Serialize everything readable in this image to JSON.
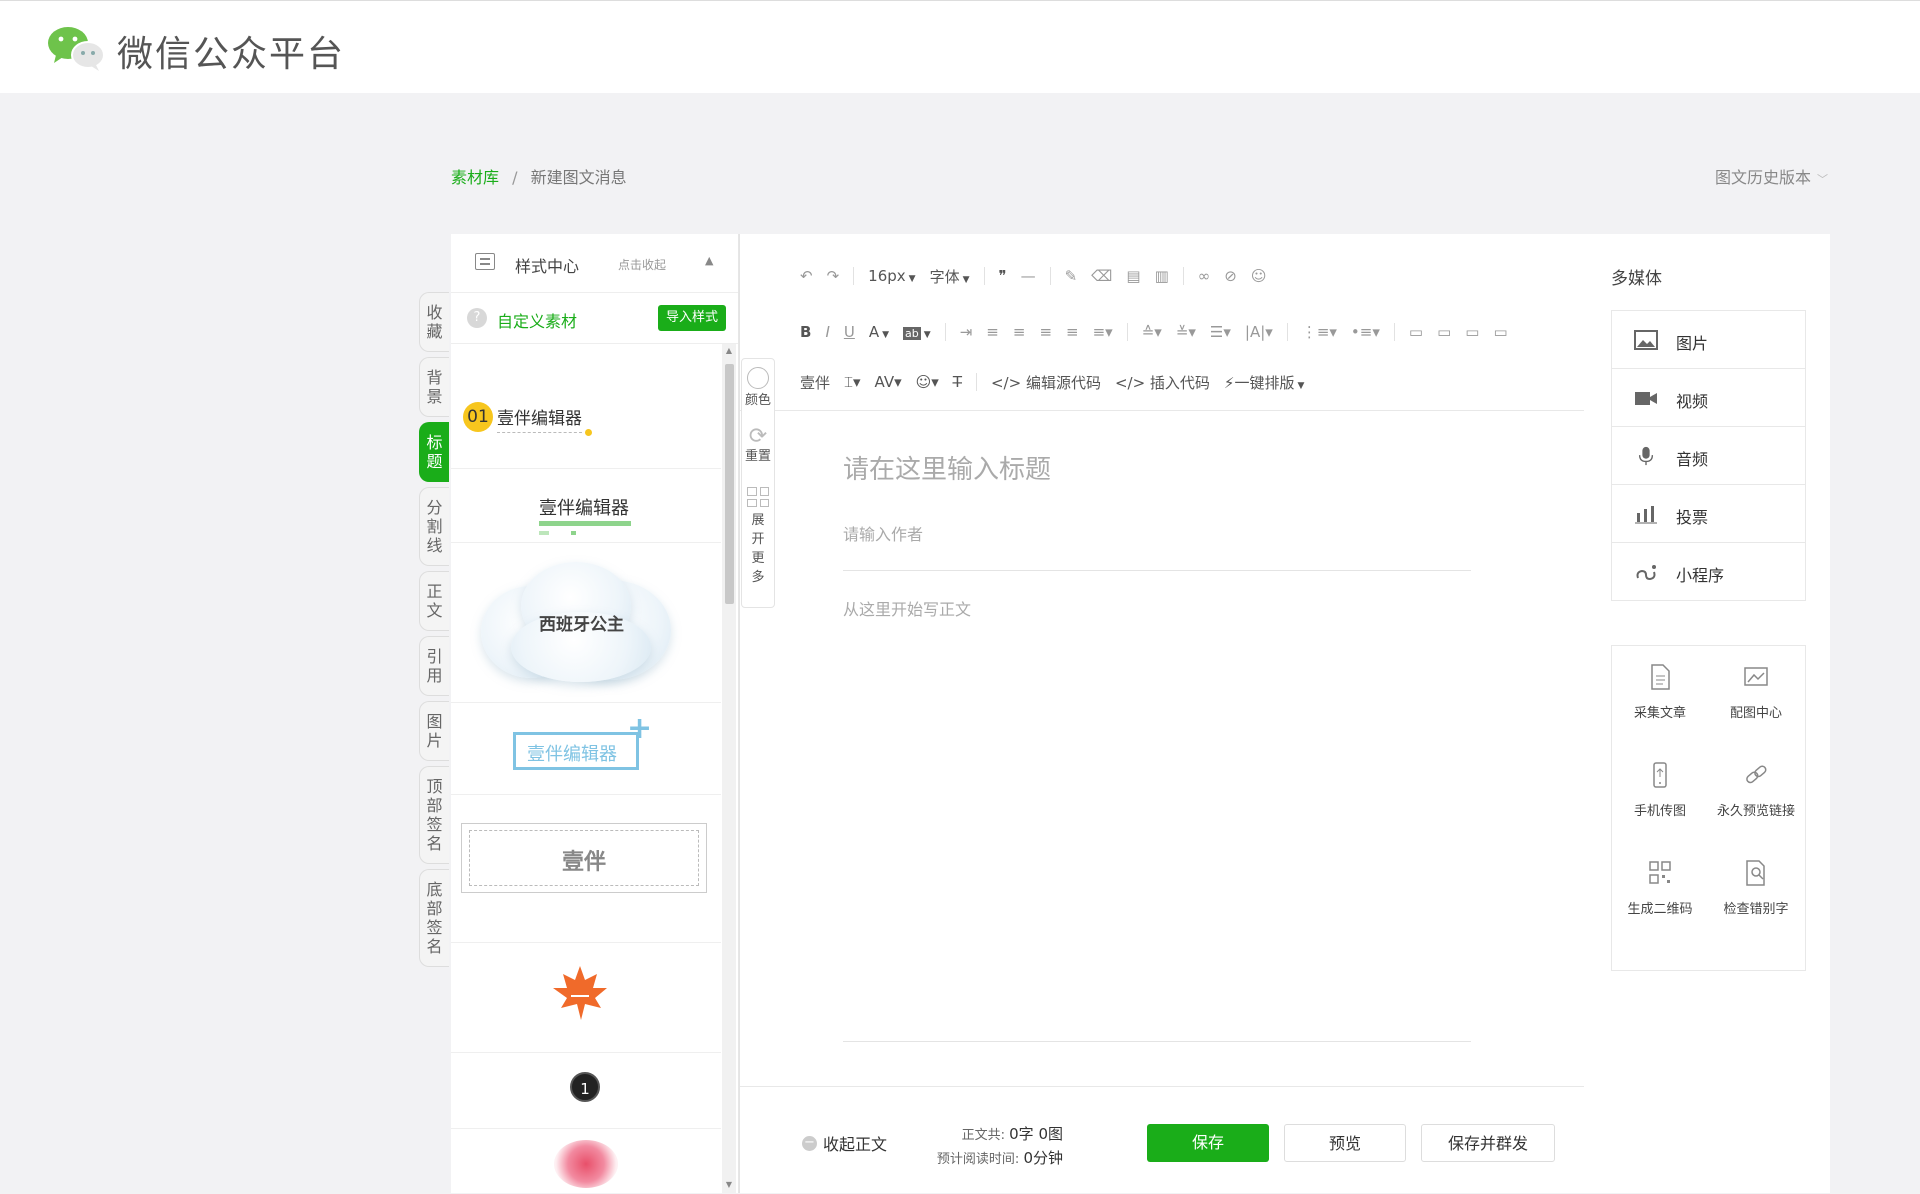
{
  "header": {
    "brand": "微信公众平台"
  },
  "breadcrumb": {
    "root": "素材库",
    "separator": "/",
    "current": "新建图文消息"
  },
  "history": {
    "label": "图文历史版本"
  },
  "vertical_tabs": [
    {
      "label": "收藏",
      "active": false
    },
    {
      "label": "背景",
      "active": false
    },
    {
      "label": "标题",
      "active": true
    },
    {
      "label": "分割线",
      "active": false
    },
    {
      "label": "正文",
      "active": false
    },
    {
      "label": "引用",
      "active": false
    },
    {
      "label": "图片",
      "active": false
    },
    {
      "label": "顶部签名",
      "active": false
    },
    {
      "label": "底部签名",
      "active": false
    }
  ],
  "style_center": {
    "title": "样式中心",
    "collapse": "点击收起",
    "custom_label": "自定义素材",
    "help": "?",
    "import_btn": "导入样式",
    "items": {
      "num": "01",
      "t1": "壹伴编辑器",
      "t2": "壹伴编辑器",
      "t3": "西班牙公主",
      "t4": "壹伴编辑器",
      "t4_plus": "+",
      "t5": "壹伴",
      "t7": "1"
    }
  },
  "side_tools": {
    "color": "颜色",
    "reset": "重置",
    "expand": "展开更多"
  },
  "toolbar": {
    "undo": "↶",
    "redo": "↷",
    "font_size": "16px",
    "font_family": "字体",
    "quote": "❞",
    "hr": "—",
    "bold": "B",
    "italic": "I",
    "underline": "U",
    "font_color": "A",
    "highlight": "ab",
    "yiban": "壹伴",
    "edit_source": "</> 编辑源代码",
    "insert_code": "</> 插入代码",
    "one_click": "⚡一键排版"
  },
  "editor": {
    "title_placeholder": "请在这里输入标题",
    "author_placeholder": "请输入作者",
    "body_placeholder": "从这里开始写正文"
  },
  "footer": {
    "fold": "收起正文",
    "stat_body_label": "正文共:",
    "stat_body_value": "0字 0图",
    "stat_time_label": "预计阅读时间:",
    "stat_time_value": "0分钟",
    "save": "保存",
    "preview": "预览",
    "save_mass": "保存并群发"
  },
  "media": {
    "title": "多媒体",
    "items": [
      {
        "label": "图片",
        "icon": "image-icon"
      },
      {
        "label": "视频",
        "icon": "video-icon"
      },
      {
        "label": "音频",
        "icon": "audio-icon"
      },
      {
        "label": "投票",
        "icon": "vote-icon"
      },
      {
        "label": "小程序",
        "icon": "mini-program-icon"
      }
    ],
    "tools": [
      {
        "label": "采集文章",
        "icon": "document-icon"
      },
      {
        "label": "配图中心",
        "icon": "picture-center-icon"
      },
      {
        "label": "手机传图",
        "icon": "phone-icon"
      },
      {
        "label": "永久预览链接",
        "icon": "link-icon"
      },
      {
        "label": "生成二维码",
        "icon": "qrcode-icon"
      },
      {
        "label": "检查错别字",
        "icon": "spellcheck-icon"
      }
    ]
  },
  "colors": {
    "accent": "#1aad19",
    "title_badge": "#f7c61e",
    "frame_blue": "#7fc3e3"
  }
}
